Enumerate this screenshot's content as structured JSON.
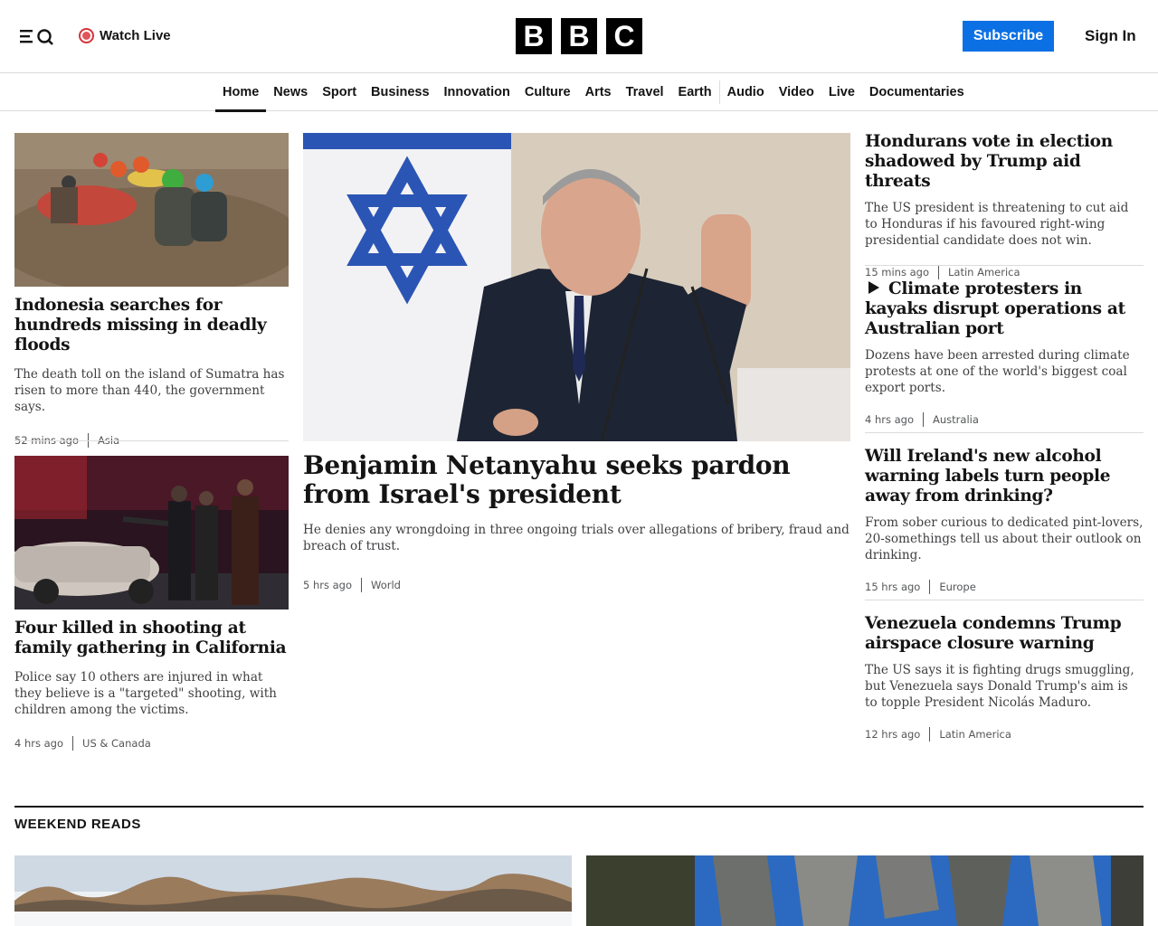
{
  "header": {
    "watch_live": "Watch Live",
    "logo_letters": [
      "B",
      "B",
      "C"
    ],
    "subscribe": "Subscribe",
    "sign_in": "Sign In",
    "accent": "#0b70e4",
    "live_color": "#d5343a"
  },
  "nav": {
    "items": [
      "Home",
      "News",
      "Sport",
      "Business",
      "Innovation",
      "Culture",
      "Arts",
      "Travel",
      "Earth",
      "Audio",
      "Video",
      "Live",
      "Documentaries"
    ],
    "active": "Home"
  },
  "left_col": [
    {
      "headline": "Indonesia searches for hundreds missing in deadly floods",
      "summary": "The death toll on the island of Sumatra has risen to more than 440, the government says.",
      "time": "52 mins ago",
      "category": "Asia"
    },
    {
      "headline": "Four killed in shooting at family gathering in California",
      "summary": "Police say 10 others are injured in what they believe is a \"targeted\" shooting, with children among the victims.",
      "time": "4 hrs ago",
      "category": "US & Canada"
    }
  ],
  "lead": {
    "headline": "Benjamin Netanyahu seeks pardon from Israel's president",
    "summary": "He denies any wrongdoing in three ongoing trials over allegations of bribery, fraud and breach of trust.",
    "time": "5 hrs ago",
    "category": "World"
  },
  "right_col": [
    {
      "headline": "Hondurans vote in election shadowed by Trump aid threats",
      "summary": "The US president is threatening to cut aid to Honduras if his favoured right-wing presidential candidate does not win.",
      "time": "15 mins ago",
      "category": "Latin America"
    },
    {
      "headline": "Climate protesters in kayaks disrupt operations at Australian port",
      "summary": "Dozens have been arrested during climate protests at one of the world's biggest coal export ports.",
      "time": "4 hrs ago",
      "category": "Australia",
      "icon": "play-icon"
    },
    {
      "headline": "Will Ireland's new alcohol warning labels turn people away from drinking?",
      "summary": "From sober curious to dedicated pint-lovers, 20-somethings tell us about their outlook on drinking.",
      "time": "15 hrs ago",
      "category": "Europe"
    },
    {
      "headline": "Venezuela condemns Trump airspace closure warning",
      "summary": "The US says it is fighting drugs smuggling, but Venezuela says Donald Trump's aim is to topple President Nicolás Maduro.",
      "time": "12 hrs ago",
      "category": "Latin America"
    }
  ],
  "section": {
    "title": "WEEKEND READS"
  }
}
